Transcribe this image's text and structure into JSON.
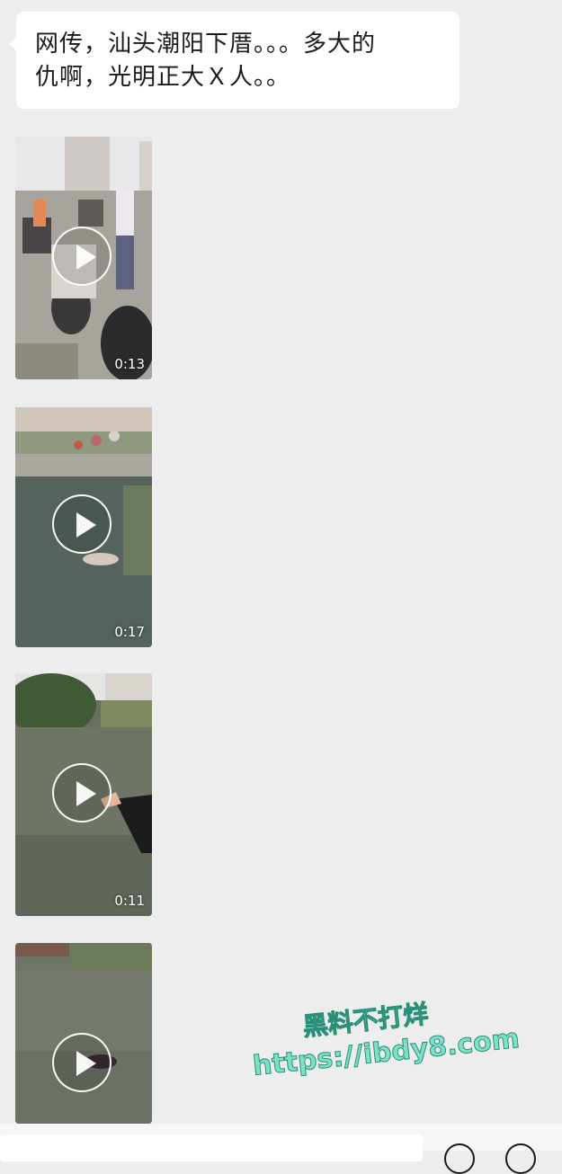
{
  "message": {
    "text": "网传，汕头潮阳下厝。。。多大的\n仇啊，光明正大Ｘ人。。"
  },
  "videos": [
    {
      "duration": "0:13"
    },
    {
      "duration": "0:17"
    },
    {
      "duration": "0:11"
    },
    {
      "duration": ""
    }
  ],
  "watermark": {
    "line1": "黑料不打烊",
    "line2": "https://ibdy8.com"
  },
  "colors": {
    "background": "#ededed",
    "bubble": "#ffffff",
    "watermark": "#7fe0c8"
  },
  "icons": [
    "play-icon",
    "voice-icon",
    "emoji-icon"
  ]
}
